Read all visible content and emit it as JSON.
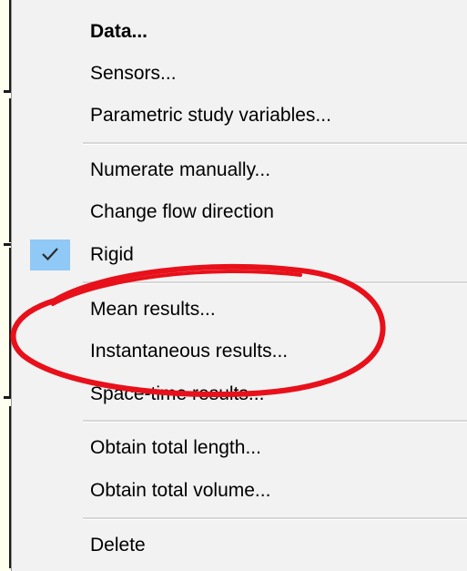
{
  "context_menu": {
    "items": [
      {
        "label": "Data...",
        "bold": true,
        "checked": false
      },
      {
        "label": "Sensors...",
        "bold": false,
        "checked": false
      },
      {
        "label": "Parametric study variables...",
        "bold": false,
        "checked": false
      },
      {
        "label": "Numerate manually...",
        "bold": false,
        "checked": false
      },
      {
        "label": "Change flow direction",
        "bold": false,
        "checked": false
      },
      {
        "label": "Rigid",
        "bold": false,
        "checked": true
      },
      {
        "label": "Mean results...",
        "bold": false,
        "checked": false
      },
      {
        "label": "Instantaneous results...",
        "bold": false,
        "checked": false
      },
      {
        "label": "Space-time results...",
        "bold": false,
        "checked": false
      },
      {
        "label": "Obtain total length...",
        "bold": false,
        "checked": false
      },
      {
        "label": "Obtain total volume...",
        "bold": false,
        "checked": false
      },
      {
        "label": "Delete",
        "bold": false,
        "checked": false
      }
    ],
    "check_icon": "checkmark-icon"
  },
  "colors": {
    "menu_background": "#f2f2f2",
    "check_highlight": "#90c8f6",
    "annotation_ellipse": "#e8101a",
    "background_window": "#fffff0"
  },
  "annotation": {
    "shape": "ellipse",
    "highlights": [
      "Mean results...",
      "Instantaneous results..."
    ]
  }
}
